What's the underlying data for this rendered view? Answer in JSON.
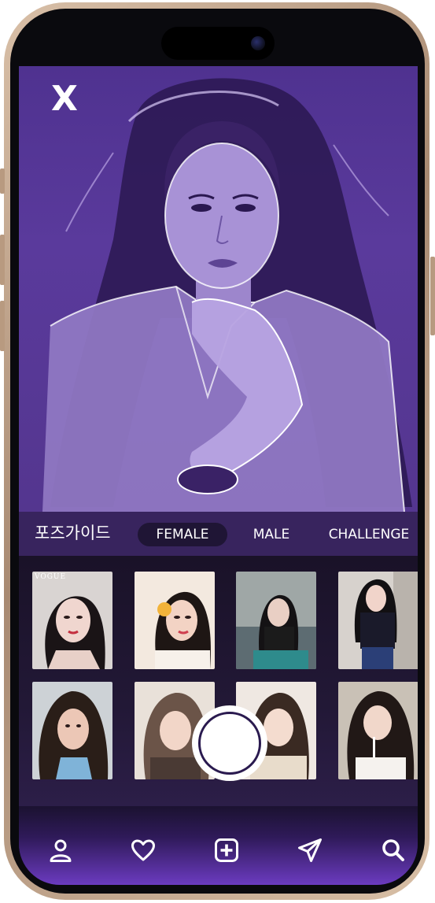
{
  "preview": {
    "close_label": "X"
  },
  "tabs": {
    "title": "포즈가이드",
    "items": [
      {
        "label": "FEMALE",
        "active": true
      },
      {
        "label": "MALE",
        "active": false
      },
      {
        "label": "CHALLENGE",
        "active": false
      }
    ]
  },
  "gallery": {
    "magazine_label": "VOGUE",
    "count": 8
  },
  "bottom_nav": {
    "items": [
      {
        "icon": "profile-icon"
      },
      {
        "icon": "heart-icon"
      },
      {
        "icon": "add-square-icon"
      },
      {
        "icon": "send-icon"
      },
      {
        "icon": "search-icon"
      }
    ]
  },
  "colors": {
    "accent": "#5a3a9c",
    "tab_active_bg": "#1f1535",
    "nav_gradient_end": "#6b3bc0"
  }
}
